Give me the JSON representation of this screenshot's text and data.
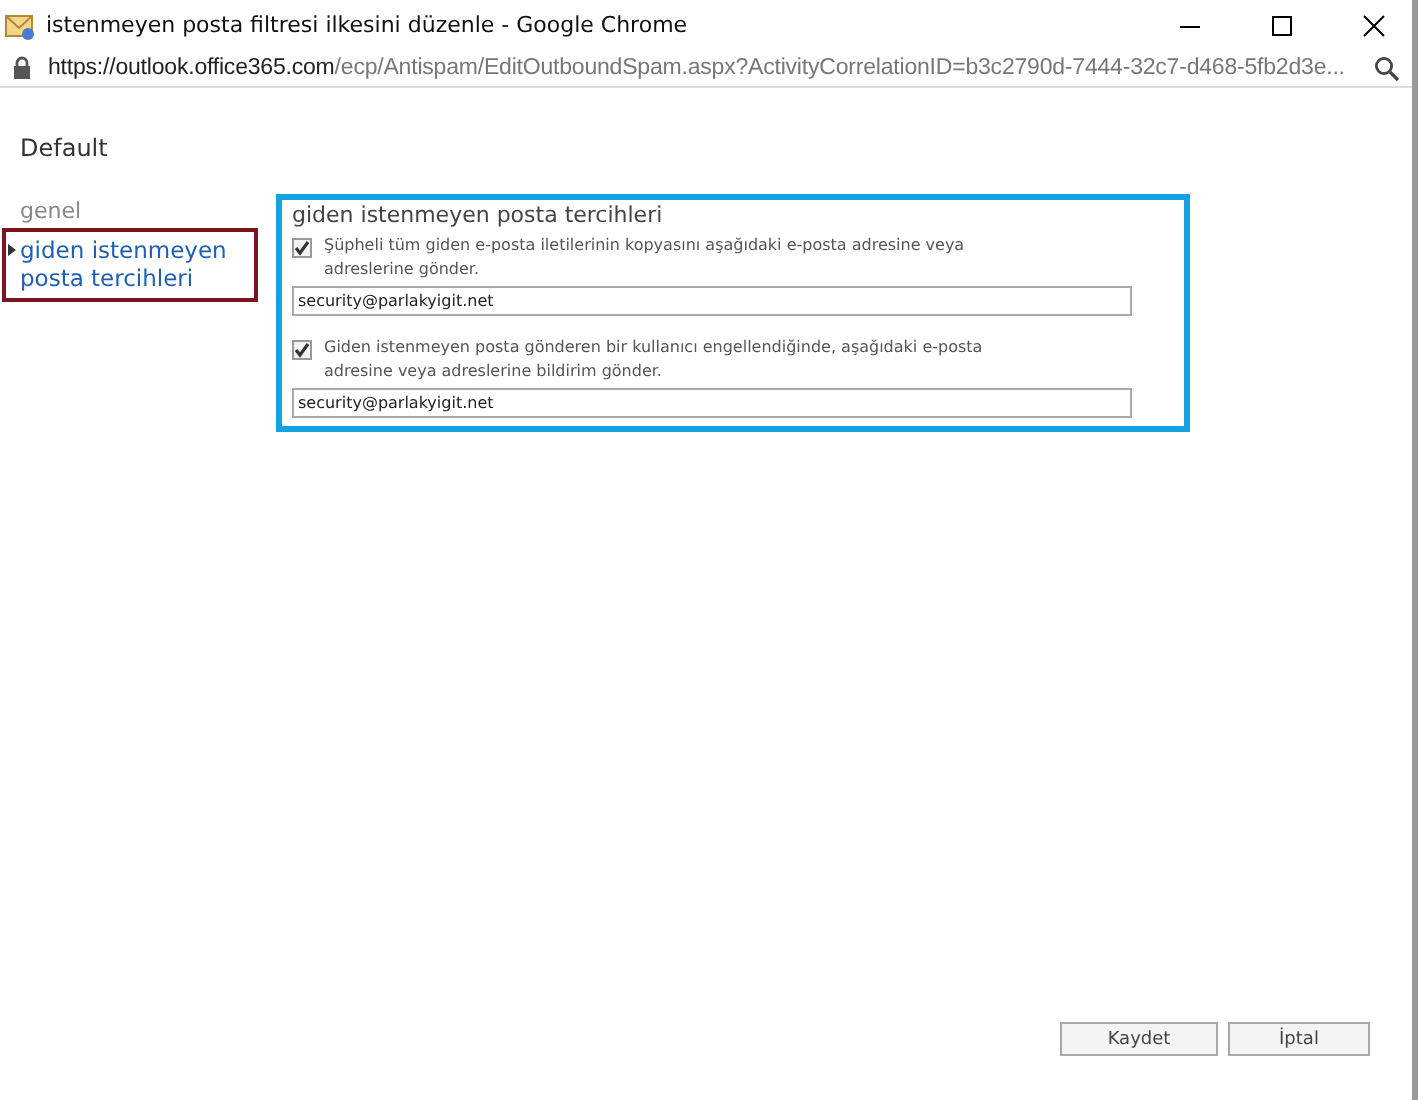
{
  "window": {
    "title": "istenmeyen posta filtresi ilkesini düzenle - Google Chrome"
  },
  "address_bar": {
    "host": "https://outlook.office365.com",
    "path": "/ecp/Antispam/EditOutboundSpam.aspx?ActivityCorrelationID=b3c2790d-7444-32c7-d468-5fb2d3e..."
  },
  "page_title": "Default",
  "sidebar": {
    "items": [
      {
        "label": "genel",
        "selected": false
      },
      {
        "label": "giden istenmeyen posta tercihleri",
        "selected": true
      }
    ]
  },
  "section": {
    "title": "giden istenmeyen posta tercihleri",
    "options": [
      {
        "label": "Şüpheli tüm giden e-posta iletilerinin kopyasını aşağıdaki e-posta adresine veya adreslerine gönder.",
        "checked": true,
        "value": "security@parlakyigit.net"
      },
      {
        "label": "Giden istenmeyen posta gönderen bir kullanıcı engellendiğinde, aşağıdaki e-posta adresine veya adreslerine bildirim gönder.",
        "checked": true,
        "value": "security@parlakyigit.net"
      }
    ]
  },
  "buttons": [
    "Kaydet",
    "İptal"
  ]
}
